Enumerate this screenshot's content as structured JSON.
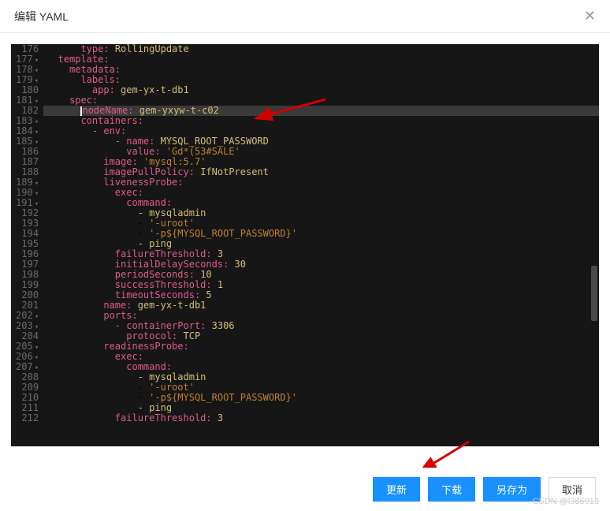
{
  "modal": {
    "title": "编辑 YAML"
  },
  "buttons": {
    "update": "更新",
    "download": "下载",
    "saveAs": "另存为",
    "cancel": "取消"
  },
  "watermark": "CSDN @l386913",
  "scrollbar": {
    "topPct": 55
  },
  "editor": {
    "startLine": 176,
    "highlightLine": 182,
    "foldLines": [
      177,
      178,
      179,
      181,
      183,
      184,
      185,
      189,
      190,
      191,
      202,
      203,
      205,
      206,
      207
    ],
    "lines": [
      {
        "n": 176,
        "seg": [
          {
            "c": "k",
            "t": "      type: "
          },
          {
            "c": "v",
            "t": "RollingUpdate"
          }
        ]
      },
      {
        "n": 177,
        "seg": [
          {
            "c": "k",
            "t": "  template:"
          }
        ]
      },
      {
        "n": 178,
        "seg": [
          {
            "c": "k",
            "t": "    metadata:"
          }
        ]
      },
      {
        "n": 179,
        "seg": [
          {
            "c": "k",
            "t": "      labels:"
          }
        ]
      },
      {
        "n": 180,
        "seg": [
          {
            "c": "k",
            "t": "        app: "
          },
          {
            "c": "v",
            "t": "gem-yx-t-db1"
          }
        ]
      },
      {
        "n": 181,
        "seg": [
          {
            "c": "k",
            "t": "    spec:"
          }
        ]
      },
      {
        "n": 182,
        "seg": [
          {
            "c": "",
            "t": "      "
          },
          {
            "c": "cursor",
            "t": ""
          },
          {
            "c": "k",
            "t": "nodeName: "
          },
          {
            "c": "v",
            "t": "gem-yxyw-t-c02"
          }
        ]
      },
      {
        "n": 183,
        "seg": [
          {
            "c": "k",
            "t": "      containers:"
          }
        ]
      },
      {
        "n": 184,
        "seg": [
          {
            "c": "k",
            "t": "        - env:"
          }
        ]
      },
      {
        "n": 185,
        "seg": [
          {
            "c": "k",
            "t": "            - name: "
          },
          {
            "c": "v",
            "t": "MYSQL_ROOT_PASSWORD"
          }
        ]
      },
      {
        "n": 186,
        "seg": [
          {
            "c": "k",
            "t": "              value: "
          },
          {
            "c": "s",
            "t": "'Gd*(53#SALE'"
          }
        ]
      },
      {
        "n": 187,
        "seg": [
          {
            "c": "k",
            "t": "          image: "
          },
          {
            "c": "s",
            "t": "'mysql:5.7'"
          }
        ]
      },
      {
        "n": 188,
        "seg": [
          {
            "c": "k",
            "t": "          imagePullPolicy: "
          },
          {
            "c": "v",
            "t": "IfNotPresent"
          }
        ]
      },
      {
        "n": 189,
        "seg": [
          {
            "c": "k",
            "t": "          livenessProbe:"
          }
        ]
      },
      {
        "n": 190,
        "seg": [
          {
            "c": "k",
            "t": "            exec:"
          }
        ]
      },
      {
        "n": 191,
        "seg": [
          {
            "c": "k",
            "t": "              command:"
          }
        ]
      },
      {
        "n": 192,
        "seg": [
          {
            "c": "v",
            "t": "                - mysqladmin"
          }
        ]
      },
      {
        "n": 193,
        "seg": [
          {
            "c": "",
            "t": "                - "
          },
          {
            "c": "s",
            "t": "'-uroot'"
          }
        ]
      },
      {
        "n": 194,
        "seg": [
          {
            "c": "",
            "t": "                - "
          },
          {
            "c": "s",
            "t": "'-p${MYSQL_ROOT_PASSWORD}'"
          }
        ]
      },
      {
        "n": 195,
        "seg": [
          {
            "c": "v",
            "t": "                - ping"
          }
        ]
      },
      {
        "n": 196,
        "seg": [
          {
            "c": "k",
            "t": "            failureThreshold: "
          },
          {
            "c": "v",
            "t": "3"
          }
        ]
      },
      {
        "n": 197,
        "seg": [
          {
            "c": "k",
            "t": "            initialDelaySeconds: "
          },
          {
            "c": "v",
            "t": "30"
          }
        ]
      },
      {
        "n": 198,
        "seg": [
          {
            "c": "k",
            "t": "            periodSeconds: "
          },
          {
            "c": "v",
            "t": "10"
          }
        ]
      },
      {
        "n": 199,
        "seg": [
          {
            "c": "k",
            "t": "            successThreshold: "
          },
          {
            "c": "v",
            "t": "1"
          }
        ]
      },
      {
        "n": 200,
        "seg": [
          {
            "c": "k",
            "t": "            timeoutSeconds: "
          },
          {
            "c": "v",
            "t": "5"
          }
        ]
      },
      {
        "n": 201,
        "seg": [
          {
            "c": "k",
            "t": "          name: "
          },
          {
            "c": "v",
            "t": "gem-yx-t-db1"
          }
        ]
      },
      {
        "n": 202,
        "seg": [
          {
            "c": "k",
            "t": "          ports:"
          }
        ]
      },
      {
        "n": 203,
        "seg": [
          {
            "c": "k",
            "t": "            - containerPort: "
          },
          {
            "c": "v",
            "t": "3306"
          }
        ]
      },
      {
        "n": 204,
        "seg": [
          {
            "c": "k",
            "t": "              protocol: "
          },
          {
            "c": "v",
            "t": "TCP"
          }
        ]
      },
      {
        "n": 205,
        "seg": [
          {
            "c": "k",
            "t": "          readinessProbe:"
          }
        ]
      },
      {
        "n": 206,
        "seg": [
          {
            "c": "k",
            "t": "            exec:"
          }
        ]
      },
      {
        "n": 207,
        "seg": [
          {
            "c": "k",
            "t": "              command:"
          }
        ]
      },
      {
        "n": 208,
        "seg": [
          {
            "c": "v",
            "t": "                - mysqladmin"
          }
        ]
      },
      {
        "n": 209,
        "seg": [
          {
            "c": "",
            "t": "                - "
          },
          {
            "c": "s",
            "t": "'-uroot'"
          }
        ]
      },
      {
        "n": 210,
        "seg": [
          {
            "c": "",
            "t": "                - "
          },
          {
            "c": "s",
            "t": "'-p${MYSQL_ROOT_PASSWORD}'"
          }
        ]
      },
      {
        "n": 211,
        "seg": [
          {
            "c": "v",
            "t": "                - ping"
          }
        ]
      },
      {
        "n": 212,
        "seg": [
          {
            "c": "k",
            "t": "            failureThreshold: "
          },
          {
            "c": "v",
            "t": "3"
          }
        ]
      }
    ]
  }
}
